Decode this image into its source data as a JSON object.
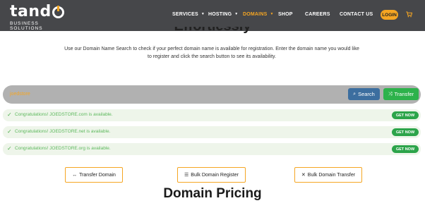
{
  "brand": {
    "name": "tando",
    "tagline": "BUSINESS SOLUTIONS"
  },
  "nav": {
    "items": [
      {
        "label": "SERVICES",
        "has_dropdown": true,
        "active": false
      },
      {
        "label": "HOSTING",
        "has_dropdown": true,
        "active": false
      },
      {
        "label": "DOMAINS",
        "has_dropdown": true,
        "active": true
      },
      {
        "label": "SHOP",
        "has_dropdown": false,
        "active": false
      },
      {
        "label": "CAREERS",
        "has_dropdown": false,
        "active": false
      },
      {
        "label": "CONTACT US",
        "has_dropdown": false,
        "active": false
      }
    ],
    "login_label": "LOGIN",
    "cart_icon": "cart-icon"
  },
  "hero": {
    "partial_heading": "Effortlessly",
    "intro": "Use our Domain Name Search to check if your perfect domain name is available for registration. Enter the domain name you would like to register and click the search button to see its availability."
  },
  "search": {
    "query": "joedstore",
    "search_label": "Search",
    "transfer_label": "Transfer"
  },
  "results": [
    {
      "message": "Congratulations! JOEDSTORE.com is available.",
      "action": "GET NOW"
    },
    {
      "message": "Congratulations! JOEDSTORE.net is available.",
      "action": "GET NOW"
    },
    {
      "message": "Congratulations! JOEDSTORE.org is available.",
      "action": "GET NOW"
    }
  ],
  "actions": {
    "transfer_domain": "Transfer Domain",
    "bulk_register": "Bulk Domain Register",
    "bulk_transfer": "Bulk Domain Transfer"
  },
  "pricing": {
    "title": "Domain Pricing"
  },
  "colors": {
    "topbar": "#46474a",
    "accent": "#f5a623",
    "search_button": "#3c6e9f",
    "transfer_button": "#2db24b",
    "success_bg": "#eef5ea",
    "success_text": "#5cb85c"
  }
}
